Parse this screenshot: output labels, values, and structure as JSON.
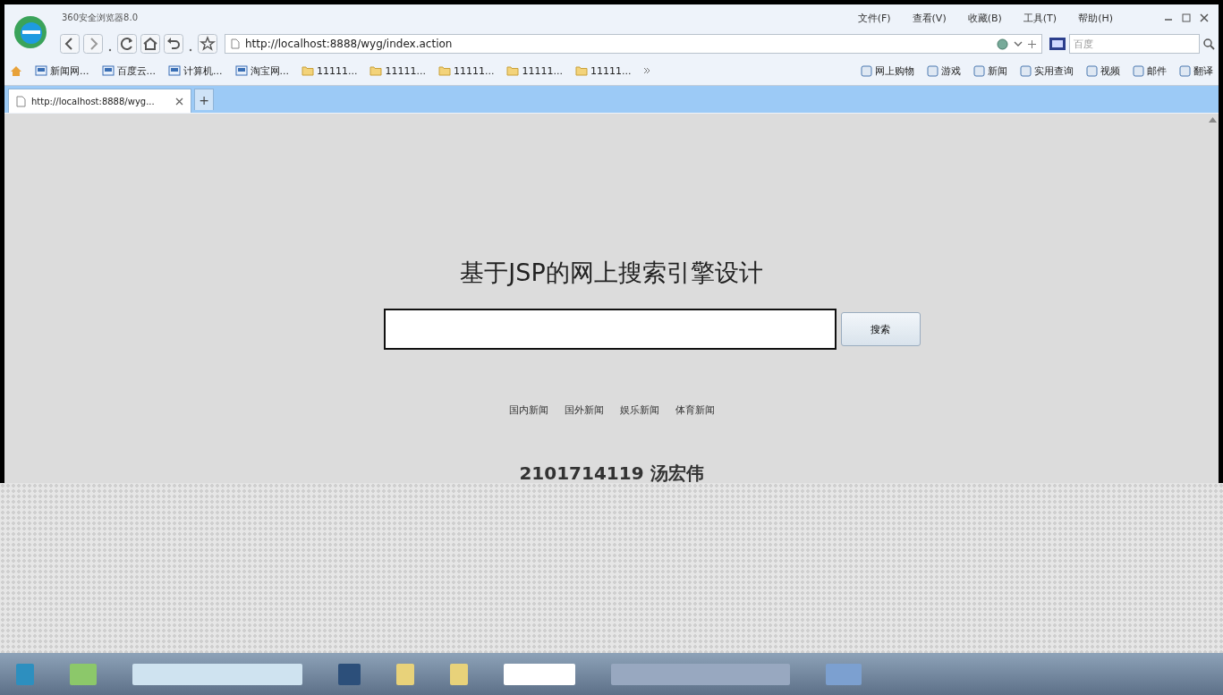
{
  "window": {
    "title": "360安全浏览器8.0"
  },
  "menu": [
    "文件(F)",
    "查看(V)",
    "收藏(B)",
    "工具(T)",
    "帮助(H)"
  ],
  "address_bar": {
    "url": "http://localhost:8888/wyg/index.action"
  },
  "search_box": {
    "placeholder": "百度"
  },
  "bookmarks": [
    {
      "label": "新闻网...",
      "kind": "page"
    },
    {
      "label": "百度云...",
      "kind": "page"
    },
    {
      "label": "计算机...",
      "kind": "page"
    },
    {
      "label": "淘宝网...",
      "kind": "page"
    },
    {
      "label": "11111...",
      "kind": "folder"
    },
    {
      "label": "11111...",
      "kind": "folder"
    },
    {
      "label": "11111...",
      "kind": "folder"
    },
    {
      "label": "11111...",
      "kind": "folder"
    },
    {
      "label": "11111...",
      "kind": "folder"
    }
  ],
  "quick_links": [
    "网上购物",
    "游戏",
    "新闻",
    "实用查询",
    "视频",
    "邮件",
    "翻译"
  ],
  "tabs": [
    {
      "label": "http://localhost:8888/wyg...",
      "selected": true
    }
  ],
  "new_tab_button": "+",
  "page": {
    "heading": "基于JSP的网上搜索引擎设计",
    "search_button": "搜索",
    "nav_links": [
      "国内新闻",
      "国外新闻",
      "娱乐新闻",
      "体育新闻"
    ],
    "footer": "2101714119 汤宏伟"
  }
}
